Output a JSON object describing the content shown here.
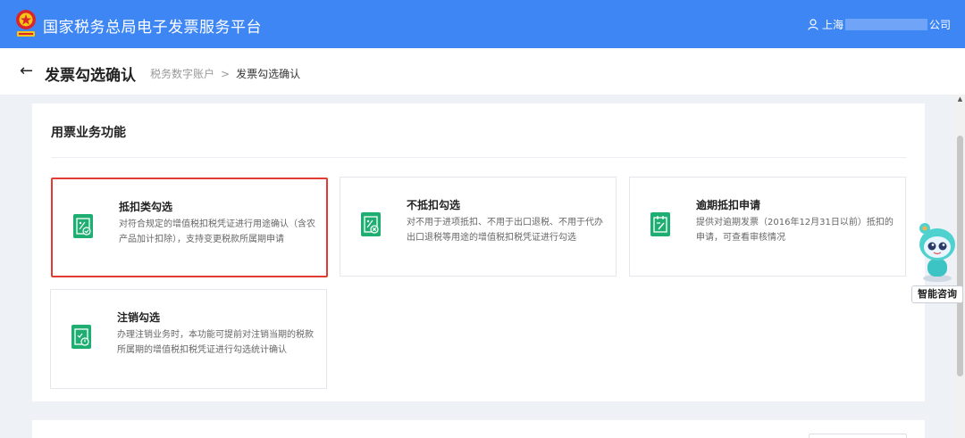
{
  "header": {
    "app_title": "国家税务总局电子发票服务平台",
    "user_prefix": "上海",
    "user_suffix": "公司",
    "emblem_icon": "tax-emblem-icon",
    "user_icon": "user-icon"
  },
  "subheader": {
    "back_icon": "arrow-left-icon",
    "page_title": "发票勾选确认",
    "breadcrumb": [
      "税务数字账户",
      "发票勾选确认"
    ],
    "breadcrumb_separator": ">"
  },
  "section": {
    "title": "用票业务功能",
    "cards": [
      {
        "title": "抵扣类勾选",
        "desc": "对符合规定的增值税扣税凭证进行用途确认（含农产品加计扣除），支持变更税款所属期申请",
        "icon": "deduction-check-icon",
        "selected": true
      },
      {
        "title": "不抵扣勾选",
        "desc": "对不用于进项抵扣、不用于出口退税、不用于代办出口退税等用途的增值税扣税凭证进行勾选",
        "icon": "no-deduction-icon",
        "selected": false
      },
      {
        "title": "逾期抵扣申请",
        "desc": "提供对逾期发票（2016年12月31日以前）抵扣的申请，可查看审核情况",
        "icon": "overdue-apply-icon",
        "selected": false
      },
      {
        "title": "注销勾选",
        "desc": "办理注销业务时，本功能可提前对注销当期的税款所属期的增值税扣税凭证进行勾选统计确认",
        "icon": "cancellation-icon",
        "selected": false
      }
    ]
  },
  "assistant": {
    "label": "智能咨询",
    "icon": "assistant-robot-icon"
  },
  "colors": {
    "header_bg": "#3f86f5",
    "card_icon_bg": "#1fae72",
    "selected_border": "#e23b34"
  }
}
